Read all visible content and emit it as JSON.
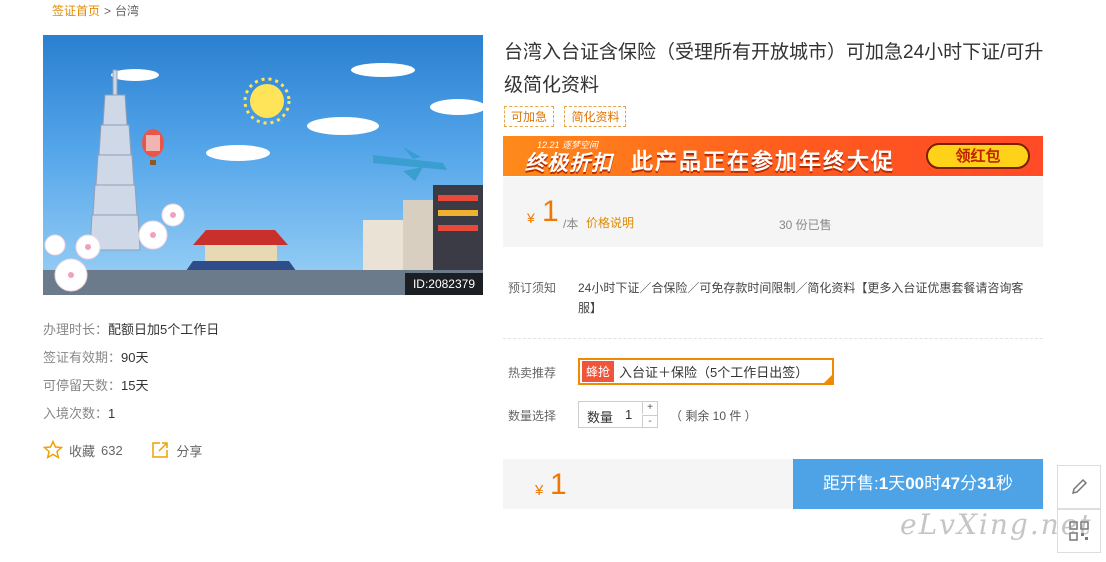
{
  "breadcrumb": {
    "home": "签证首页",
    "sep": ">",
    "current": "台湾"
  },
  "hero": {
    "id_label": "ID:2082379"
  },
  "left_info": [
    {
      "label": "办理时长：",
      "value": "配额日加5个工作日"
    },
    {
      "label": "签证有效期：",
      "value": "90天"
    },
    {
      "label": "可停留天数：",
      "value": "15天"
    },
    {
      "label": "入境次数：",
      "value": "1"
    }
  ],
  "actions": {
    "favorite_label": "收藏",
    "favorite_count": "632",
    "share_label": "分享"
  },
  "product": {
    "title": "台湾入台证含保险（受理所有开放城市）可加急24小时下证/可升级简化资料",
    "tags": [
      "可加急",
      "简化资料"
    ]
  },
  "promo": {
    "small": "12.21 逐梦空间",
    "big": "终极折扣",
    "main": "此产品正在参加年终大促",
    "button": "领红包"
  },
  "price": {
    "currency": "¥",
    "value": "1",
    "unit": "/本",
    "explain": "价格说明",
    "sold": "30 份已售"
  },
  "booking": {
    "notice_label": "预订须知",
    "notice_text": "24小时下证／合保险／可免存款时间限制／简化资料【更多入台证优惠套餐请咨询客服】",
    "hot_label": "热卖推荐",
    "hot_badge": "蜂抢",
    "hot_text": "入台证＋保险（5个工作日出签）",
    "qty_label": "数量选择",
    "qty_field_label": "数量",
    "qty_value": "1",
    "plus": "+",
    "minus": "-",
    "remain": "（ 剩余 10 件 ）"
  },
  "buy": {
    "currency": "¥",
    "value": "1",
    "countdown_prefix": "距开售:",
    "days": "1",
    "days_unit": "天",
    "hours": "00",
    "hours_unit": "时",
    "minutes": "47",
    "minutes_unit": "分",
    "seconds": "31",
    "seconds_unit": "秒"
  },
  "watermark": "eLvXing.net",
  "icons": {
    "favorite": "star-outline-icon",
    "share": "share-arrow-icon",
    "side_edit": "pencil-icon",
    "side_qr": "qr-code-icon"
  },
  "colors": {
    "accent_orange": "#f07800",
    "countdown_blue": "#4da3e6",
    "promo_red": "#ff5a1f"
  }
}
